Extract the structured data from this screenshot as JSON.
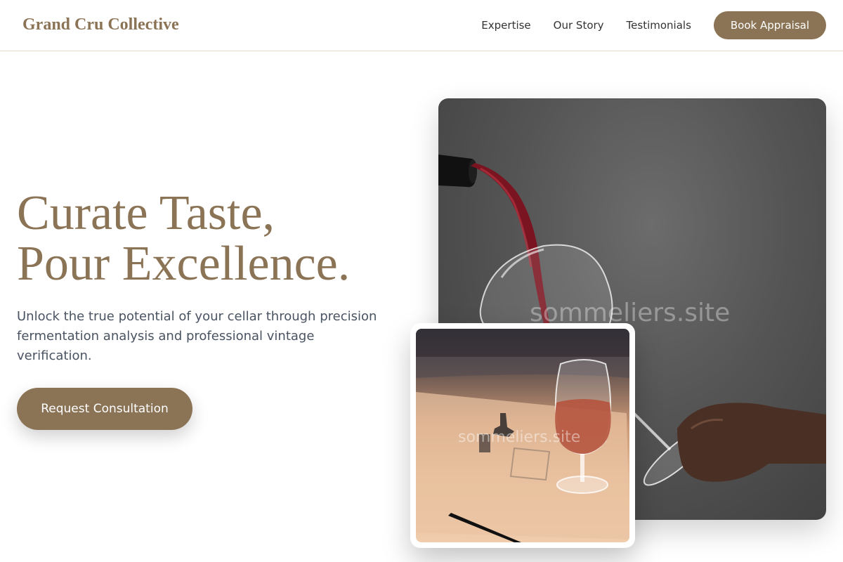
{
  "brand": {
    "name": "Grand Cru Collective",
    "accent_color": "#8b7355"
  },
  "nav": {
    "links": [
      {
        "label": "Expertise"
      },
      {
        "label": "Our Story"
      },
      {
        "label": "Testimonials"
      }
    ],
    "cta_label": "Book Appraisal"
  },
  "hero": {
    "title_line1": "Curate Taste,",
    "title_line2": "Pour Excellence.",
    "subtitle": "Unlock the true potential of your cellar through precision fermentation analysis and professional vintage verification.",
    "cta_label": "Request Consultation"
  },
  "images": {
    "main": {
      "subject": "wine pouring from bottle into glass",
      "watermark": "sommeliers.site"
    },
    "inset": {
      "subject": "glass of rosé wine on tasting notes",
      "watermark": "sommeliers.site"
    }
  }
}
